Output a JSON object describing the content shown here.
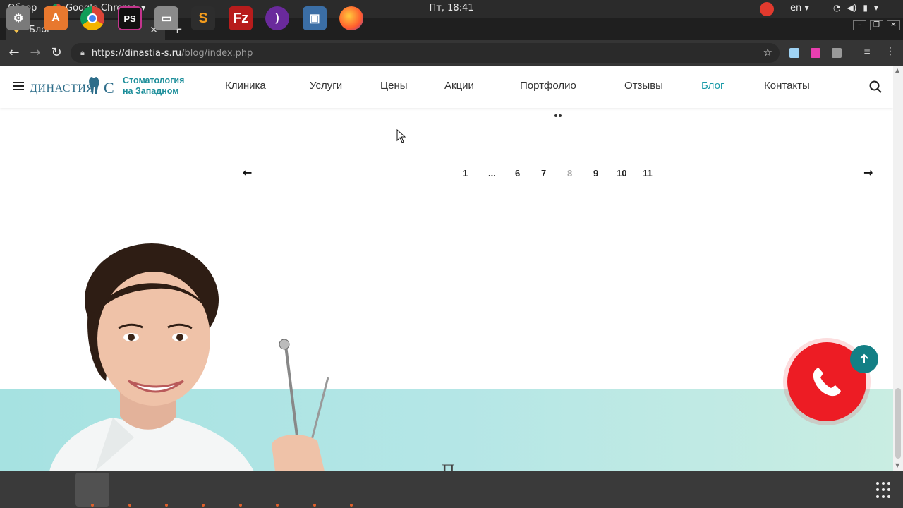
{
  "system_bar": {
    "overview": "Обзор",
    "app_name": "Google Chrome",
    "clock": "Пт, 18:41",
    "lang": "en"
  },
  "browser": {
    "tab_title": "Блог",
    "url_host": "https://dinastia-s.ru",
    "url_path": "/blog/index.php"
  },
  "site": {
    "logo_name": "ДИНАСТИЯ",
    "logo_letter": "C",
    "logo_tagline_1": "Стоматология",
    "logo_tagline_2": "на Западном",
    "menu": [
      {
        "label": "Клиника"
      },
      {
        "label": "Услуги"
      },
      {
        "label": "Цены"
      },
      {
        "label": "Акции"
      },
      {
        "label": "Портфолио"
      },
      {
        "label": "Отзывы"
      },
      {
        "label": "Блог",
        "active": true
      },
      {
        "label": "Контакты"
      }
    ],
    "accent_color": "#1a9aa8",
    "call_color": "#ed1c24"
  },
  "pagination": {
    "pages": [
      "1",
      "...",
      "6",
      "7",
      "8",
      "9",
      "10",
      "11"
    ],
    "current": "8"
  },
  "banner": {
    "fragment": "П"
  },
  "dock": {
    "apps": [
      "settings",
      "software-center",
      "chrome",
      "phpstorm",
      "file-manager",
      "sublime-text",
      "filezilla",
      "tor-browser",
      "virtualbox",
      "firefox"
    ]
  }
}
